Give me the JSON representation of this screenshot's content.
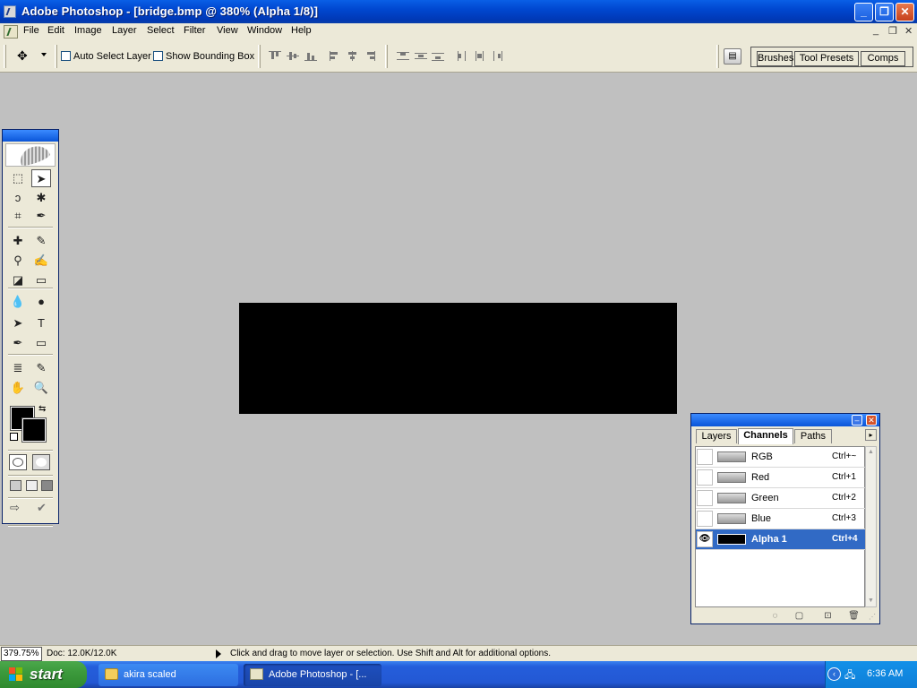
{
  "window": {
    "title": "Adobe Photoshop - [bridge.bmp @ 380% (Alpha 1/8)]",
    "min_label": "_",
    "max_label": "❐",
    "close_label": "✕"
  },
  "menu": {
    "items": [
      "File",
      "Edit",
      "Image",
      "Layer",
      "Select",
      "Filter",
      "View",
      "Window",
      "Help"
    ],
    "doc_controls": [
      "_",
      "❐",
      "✕"
    ]
  },
  "options": {
    "auto_select_label": "Auto Select Layer",
    "bounding_box_label": "Show Bounding Box",
    "auto_select_checked": false,
    "bounding_box_checked": false,
    "palette_well_tabs": [
      "Brushes",
      "Tool Presets",
      "Comps"
    ]
  },
  "tools": {
    "icons": [
      "marquee-icon",
      "move-icon",
      "lasso-icon",
      "magic-wand-icon",
      "crop-icon",
      "slice-icon",
      "healing-brush-icon",
      "brush-icon",
      "clone-stamp-icon",
      "history-brush-icon",
      "eraser-icon",
      "gradient-icon",
      "blur-icon",
      "dodge-icon",
      "path-select-icon",
      "type-icon",
      "pen-icon",
      "shape-icon",
      "notes-icon",
      "eyedropper-icon",
      "hand-icon",
      "zoom-icon"
    ],
    "glyphs": [
      "⬚",
      "➤",
      "ↄ",
      "✱",
      "⌗",
      "✒",
      "✚",
      "✎",
      "⚲",
      "✍",
      "◪",
      "▭",
      "💧",
      "●",
      "➤",
      "T",
      "✒",
      "▭",
      "≣",
      "✎",
      "✋",
      "🔍"
    ],
    "foreground_color": "#000000",
    "background_color": "#000000"
  },
  "canvas": {
    "fill": "#000000"
  },
  "channels_panel": {
    "tabs": [
      "Layers",
      "Channels",
      "Paths"
    ],
    "active_tab": "Channels",
    "menu_label": "▸",
    "channels": [
      {
        "name": "RGB",
        "shortcut": "Ctrl+~",
        "visible": false,
        "selected": false
      },
      {
        "name": "Red",
        "shortcut": "Ctrl+1",
        "visible": false,
        "selected": false
      },
      {
        "name": "Green",
        "shortcut": "Ctrl+2",
        "visible": false,
        "selected": false
      },
      {
        "name": "Blue",
        "shortcut": "Ctrl+3",
        "visible": false,
        "selected": false
      },
      {
        "name": "Alpha 1",
        "shortcut": "Ctrl+4",
        "visible": true,
        "selected": true
      }
    ],
    "eye_glyph": "👁",
    "footer_glyphs": [
      "◌",
      "▢",
      "⊡",
      "🗑"
    ]
  },
  "status": {
    "zoom": "379.75%",
    "doc_size": "Doc: 12.0K/12.0K",
    "hint": "Click and drag to move layer or selection.  Use Shift and Alt for additional options."
  },
  "taskbar": {
    "start_label": "start",
    "tasks": [
      {
        "label": "akira scaled",
        "active": false
      },
      {
        "label": "Adobe Photoshop - [...",
        "active": true
      }
    ],
    "clock": "6:36 AM"
  },
  "colors": {
    "xp_blue": "#0047d0",
    "selection_blue": "#316ac5",
    "workspace_gray": "#c0c0c0",
    "panel_beige": "#ece9d8"
  }
}
